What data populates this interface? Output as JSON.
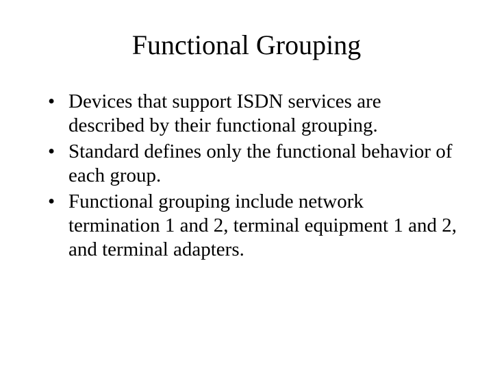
{
  "title": "Functional Grouping",
  "bullets": [
    "Devices that support ISDN services are described by their functional grouping.",
    "Standard defines only the functional behavior of each group.",
    "Functional grouping include network termination 1 and 2, terminal equipment 1 and 2, and terminal adapters."
  ]
}
